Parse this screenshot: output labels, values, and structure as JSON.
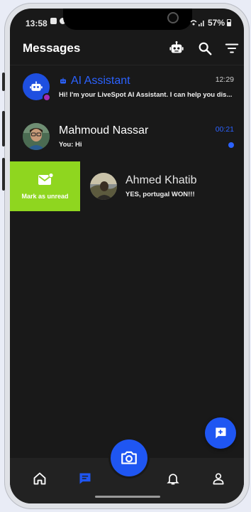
{
  "status_bar": {
    "time": "13:58",
    "battery": "57%"
  },
  "header": {
    "title": "Messages"
  },
  "chats": [
    {
      "name": "AI Assistant",
      "message": "Hi! I'm your LiveSpot AI Assistant. I can help you dis...",
      "time": "12:29"
    },
    {
      "name": "Mahmoud Nassar",
      "message": "You: Hi",
      "time": "00:21",
      "unread": true
    },
    {
      "name": "Ahmed Khatib",
      "message": "YES, portugal WON!!!",
      "swipe_action": "Mark as unread"
    }
  ],
  "colors": {
    "accent": "#1f56f2",
    "link_blue": "#2b62ff",
    "swipe_green": "#8fd61f",
    "background": "#191919"
  },
  "nav": [
    "home-icon",
    "messages-icon",
    "camera-icon",
    "bell-icon",
    "profile-icon"
  ]
}
